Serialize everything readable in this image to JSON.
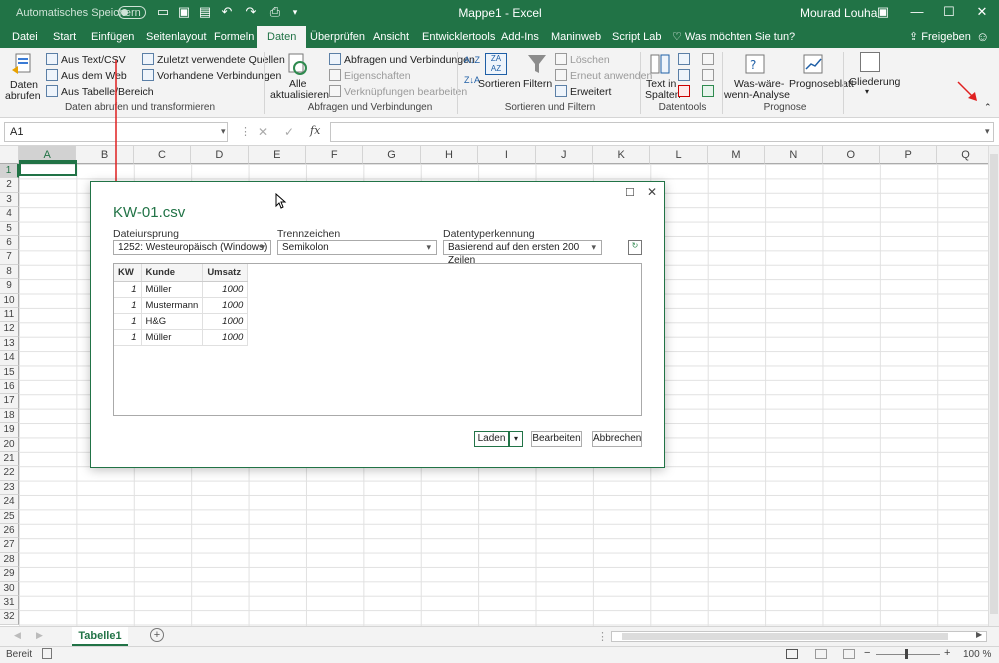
{
  "titlebar": {
    "autosave": "Automatisches Speichern",
    "doc_title": "Mappe1 - Excel",
    "user": "Mourad Louha"
  },
  "tabs": [
    "Datei",
    "Start",
    "Einfügen",
    "Seitenlayout",
    "Formeln",
    "Daten",
    "Überprüfen",
    "Ansicht",
    "Entwicklertools",
    "Add-Ins",
    "Maninweb",
    "Script Lab"
  ],
  "tellme": "Was möchten Sie tun?",
  "share": "Freigeben",
  "ribbon": {
    "get_data": "Daten",
    "get_data2": "abrufen",
    "from_text": "Aus Text/CSV",
    "from_web": "Aus dem Web",
    "from_table": "Aus Tabelle/Bereich",
    "recent_sources": "Zuletzt verwendete Quellen",
    "existing_conn": "Vorhandene Verbindungen",
    "group1": "Daten abrufen und transformieren",
    "refresh_all": "Alle",
    "refresh_all2": "aktualisieren",
    "queries_conn": "Abfragen und Verbindungen",
    "properties": "Eigenschaften",
    "edit_links": "Verknüpfungen bearbeiten",
    "group2": "Abfragen und Verbindungen",
    "sort": "Sortieren",
    "filter": "Filtern",
    "clear": "Löschen",
    "reapply": "Erneut anwenden",
    "advanced": "Erweitert",
    "group3": "Sortieren und Filtern",
    "text_to_cols": "Text in",
    "text_to_cols2": "Spalten",
    "group4": "Datentools",
    "whatif": "Was-wäre-",
    "whatif2": "wenn-Analyse",
    "forecast": "Prognoseblatt",
    "group5": "Prognose",
    "outline": "Gliederung"
  },
  "namebox": "A1",
  "columns": [
    "A",
    "B",
    "C",
    "D",
    "E",
    "F",
    "G",
    "H",
    "I",
    "J",
    "K",
    "L",
    "M",
    "N",
    "O",
    "P",
    "Q"
  ],
  "rows": [
    "1",
    "2",
    "3",
    "4",
    "5",
    "6",
    "7",
    "8",
    "9",
    "10",
    "11",
    "12",
    "13",
    "14",
    "15",
    "16",
    "17",
    "18",
    "19",
    "20",
    "21",
    "22",
    "23",
    "24",
    "25",
    "26",
    "27",
    "28",
    "29",
    "30",
    "31",
    "32"
  ],
  "sheet_tab": "Tabelle1",
  "status": {
    "ready": "Bereit",
    "zoom": "100 %"
  },
  "dialog": {
    "title": "KW-01.csv",
    "origin_label": "Dateiursprung",
    "origin_value": "1252: Westeuropäisch (Windows)",
    "delim_label": "Trennzeichen",
    "delim_value": "Semikolon",
    "detect_label": "Datentyperkennung",
    "detect_value": "Basierend auf den ersten 200 Zeilen",
    "table": {
      "headers": [
        "KW",
        "Kunde",
        "Umsatz"
      ],
      "rows": [
        [
          "1",
          "Müller",
          "1000"
        ],
        [
          "1",
          "Mustermann",
          "1000"
        ],
        [
          "1",
          "H&G",
          "1000"
        ],
        [
          "1",
          "Müller",
          "1000"
        ]
      ]
    },
    "load": "Laden",
    "edit": "Bearbeiten",
    "cancel": "Abbrechen"
  },
  "colors": {
    "excel_green": "#217346",
    "annotation": "#e02020"
  }
}
